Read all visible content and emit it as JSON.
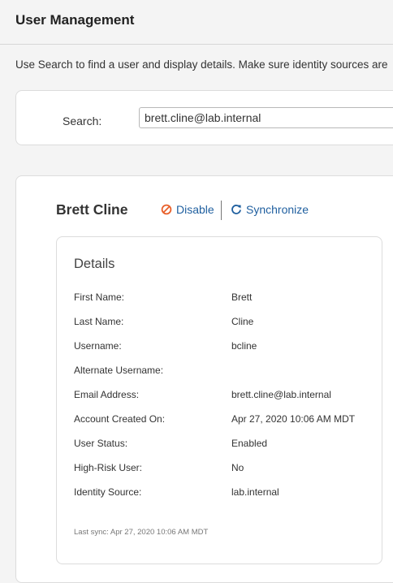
{
  "header": {
    "title": "User Management"
  },
  "intro_text": "Use Search to find a user and display details. Make sure identity sources are",
  "search": {
    "label": "Search:",
    "value": "brett.cline@lab.internal"
  },
  "user": {
    "name": "Brett Cline",
    "actions": {
      "disable": {
        "label": "Disable",
        "icon": "disable-icon",
        "color": "#e8612c"
      },
      "synchronize": {
        "label": "Synchronize",
        "icon": "refresh-icon",
        "color": "#1f5f9f"
      }
    }
  },
  "details": {
    "title": "Details",
    "fields": [
      {
        "label": "First Name:",
        "value": "Brett"
      },
      {
        "label": "Last Name:",
        "value": "Cline"
      },
      {
        "label": "Username:",
        "value": "bcline"
      },
      {
        "label": "Alternate Username:",
        "value": ""
      },
      {
        "label": "Email Address:",
        "value": "brett.cline@lab.internal"
      },
      {
        "label": "Account Created On:",
        "value": "Apr 27, 2020 10:06 AM MDT"
      },
      {
        "label": "User Status:",
        "value": "Enabled"
      },
      {
        "label": "High-Risk User:",
        "value": "No"
      },
      {
        "label": "Identity Source:",
        "value": "lab.internal"
      }
    ],
    "last_sync": "Last sync: Apr 27, 2020 10:06 AM MDT"
  }
}
